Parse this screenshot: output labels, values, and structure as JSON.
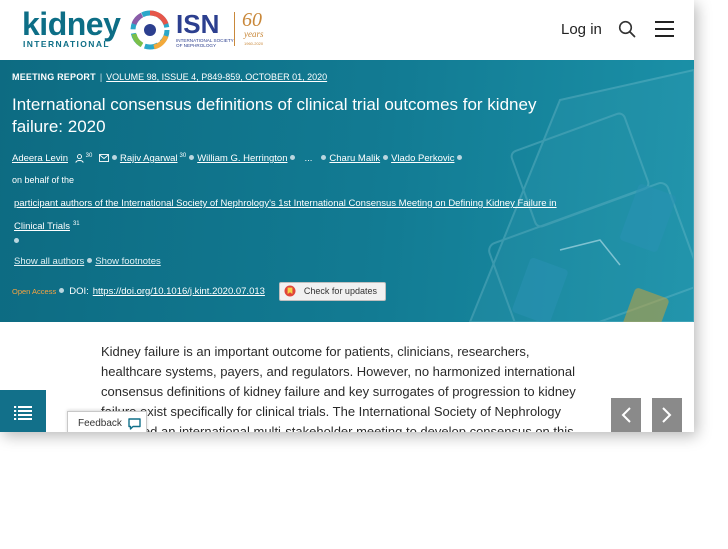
{
  "header": {
    "journal_logo": {
      "word": "kidney",
      "sub": "INTERNATIONAL"
    },
    "society_logo": {
      "word": "ISN",
      "sub": "INTERNATIONAL SOCIETY OF NEPHROLOGY",
      "anniversary": "60",
      "anniversary_sub": "years",
      "anniversary_range": "1960-2020"
    },
    "login_label": "Log in",
    "search_icon": "search-icon",
    "menu_icon": "hamburger-menu-icon"
  },
  "article": {
    "type": "MEETING REPORT",
    "separator": "|",
    "volume_info": "VOLUME 98, ISSUE 4, P849-859, OCTOBER 01, 2020",
    "title": "International consensus definitions of clinical trial outcomes for kidney failure: 2020",
    "authors": [
      {
        "name": "Adeera Levin",
        "sup": "30"
      },
      {
        "name": "Rajiv Agarwal",
        "sup": "30"
      },
      {
        "name": "William G. Herrington"
      },
      {
        "ellipsis": "..."
      },
      {
        "name": "Charu Malik"
      },
      {
        "name": "Vlado Perkovic"
      }
    ],
    "on_behalf": "on behalf of the",
    "group_name": "participant authors of the International Society of Nephrology's 1st International Consensus Meeting on Defining Kidney Failure in Clinical Trials",
    "group_sup": "31",
    "show_all_authors": "Show all authors",
    "show_footnotes": "Show footnotes",
    "open_access": "Open Access",
    "doi_label": "DOI:",
    "doi_link": "https://doi.org/10.1016/j.kint.2020.07.013",
    "check_updates": "Check for updates"
  },
  "abstract": {
    "text": "Kidney failure is an important outcome for patients, clinicians, researchers, healthcare systems, payers, and regulators. However, no harmonized international consensus definitions of kidney failure and key surrogates of progression to kidney failure exist specifically for clinical trials. The International Society of Nephrology convened an international multi-stakeholder meeting to develop consensus on this topic. A core"
  },
  "controls": {
    "toc_icon": "table-of-contents-icon",
    "feedback_label": "Feedback",
    "prev_icon": "chevron-left-icon",
    "next_icon": "chevron-right-icon"
  },
  "colors": {
    "brand_teal": "#0d6e86",
    "banner": "#127b93",
    "open_access": "#f5a340",
    "isn_blue": "#2c3f8f",
    "anniversary_gold": "#c9883a"
  }
}
